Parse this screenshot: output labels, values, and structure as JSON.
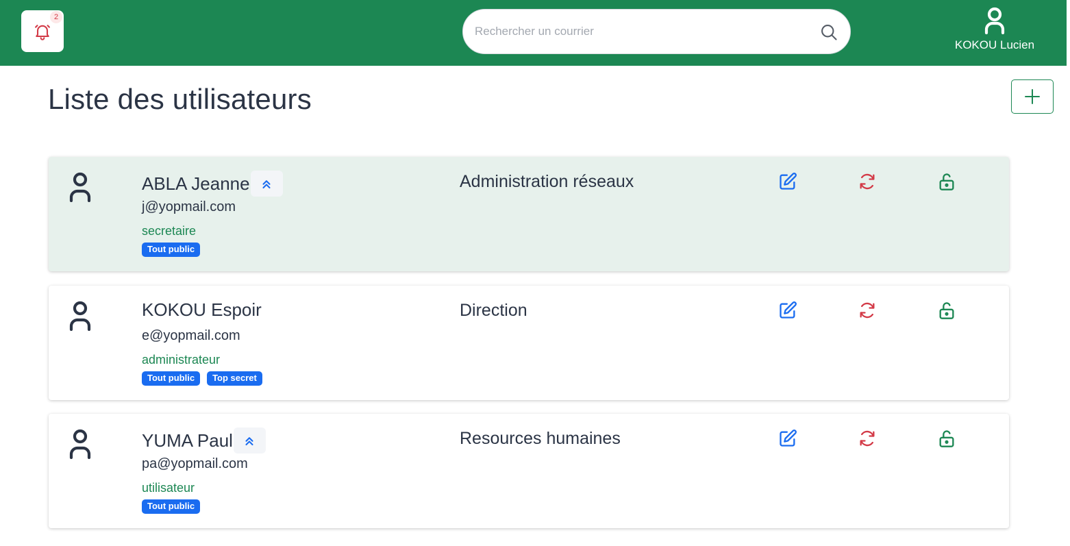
{
  "header": {
    "notification_count": "2",
    "search_placeholder": "Rechercher un courrier",
    "user_name": "KOKOU Lucien"
  },
  "page": {
    "title": "Liste des utilisateurs"
  },
  "users": [
    {
      "name": "ABLA Jeanne",
      "email": "j@yopmail.com",
      "role": "secretaire",
      "department": "Administration réseaux",
      "badges": [
        "Tout public"
      ],
      "highlighted": true,
      "promote_icon": true
    },
    {
      "name": "KOKOU Espoir",
      "email": "e@yopmail.com",
      "role": "administrateur",
      "department": "Direction",
      "badges": [
        "Tout public",
        "Top secret"
      ],
      "highlighted": false,
      "promote_icon": false
    },
    {
      "name": "YUMA Paul",
      "email": "pa@yopmail.com",
      "role": "utilisateur",
      "department": "Resources humaines",
      "badges": [
        "Tout public"
      ],
      "highlighted": false,
      "promote_icon": true
    }
  ],
  "colors": {
    "brand_green": "#1c8753",
    "highlight_row": "#e7f1ec",
    "badge_blue": "#1a6cf0",
    "edit_blue": "#1a6cf0",
    "reset_red": "#d33a47"
  },
  "icons": {
    "notification": "bell-icon",
    "search": "search-icon",
    "user": "user-icon",
    "add": "plus-icon",
    "promote": "double-chevron-up-icon",
    "edit": "edit-icon",
    "reset": "refresh-icon",
    "lock": "unlock-icon"
  }
}
